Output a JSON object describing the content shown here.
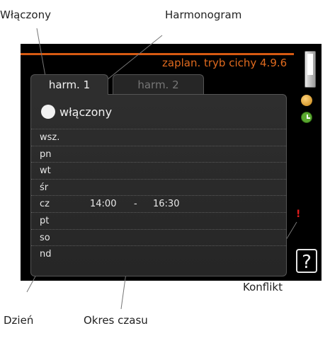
{
  "callouts": {
    "wlaczony": "Włączony",
    "harmonogram": "Harmonogram",
    "konflikt": "Konflikt",
    "dzien": "Dzień",
    "okres_czasu": "Okres czasu"
  },
  "screen": {
    "title": "zaplan. tryb cichy 4.9.6",
    "accent_color": "#d65a12",
    "tabs": [
      {
        "label": "harm. 1",
        "active": true
      },
      {
        "label": "harm. 2",
        "active": false
      }
    ],
    "toggle_label": "włączony",
    "days": [
      {
        "day": "wsz.",
        "start": "",
        "dash": "",
        "end": ""
      },
      {
        "day": "pn",
        "start": "",
        "dash": "",
        "end": ""
      },
      {
        "day": "wt",
        "start": "",
        "dash": "",
        "end": ""
      },
      {
        "day": "śr",
        "start": "",
        "dash": "",
        "end": ""
      },
      {
        "day": "cz",
        "start": "14:00",
        "dash": "-",
        "end": "16:30"
      },
      {
        "day": "pt",
        "start": "",
        "dash": "",
        "end": ""
      },
      {
        "day": "so",
        "start": "",
        "dash": "",
        "end": ""
      },
      {
        "day": "nd",
        "start": "",
        "dash": "",
        "end": ""
      }
    ],
    "conflict_mark": "!",
    "help_label": "?",
    "icons": [
      "display-icon",
      "smiley-icon",
      "clock-icon"
    ]
  }
}
